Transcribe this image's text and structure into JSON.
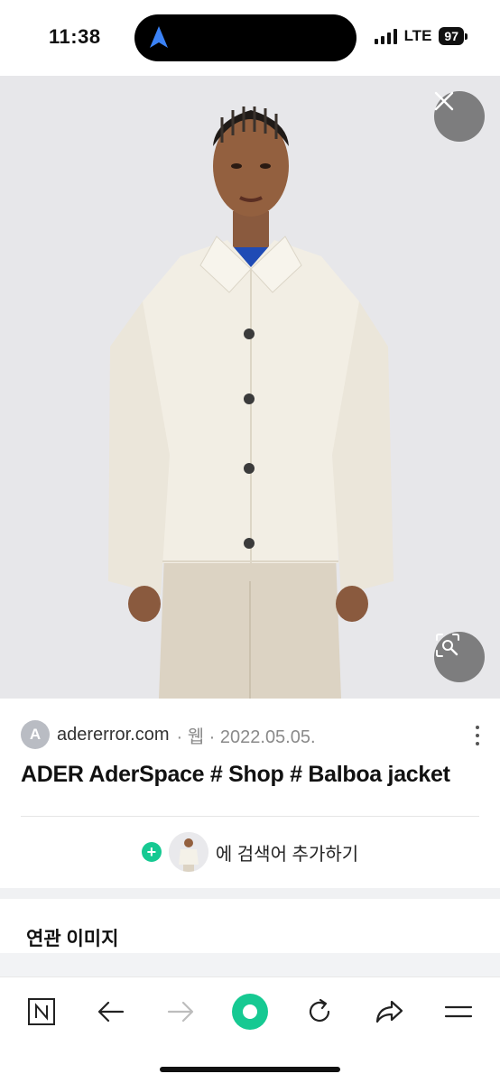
{
  "status_bar": {
    "time": "11:38",
    "network": "LTE",
    "battery": "97"
  },
  "image": {
    "close_icon": "close-icon",
    "lens_icon": "image-search-icon"
  },
  "result": {
    "favicon_letter": "A",
    "domain": "adererror.com",
    "meta": "· 웹 · 2022.05.05.",
    "title": "ADER AderSpace # Shop # Balboa jacket",
    "add_keyword_label": "에 검색어 추가하기"
  },
  "related": {
    "title": "연관 이미지"
  },
  "toolbar": {
    "items": [
      "home-n-icon",
      "back-arrow-icon",
      "forward-arrow-icon",
      "green-dot-icon",
      "refresh-icon",
      "share-icon",
      "menu-icon"
    ]
  },
  "colors": {
    "accent_green": "#16c992",
    "photo_bg": "#e7e7ea"
  }
}
